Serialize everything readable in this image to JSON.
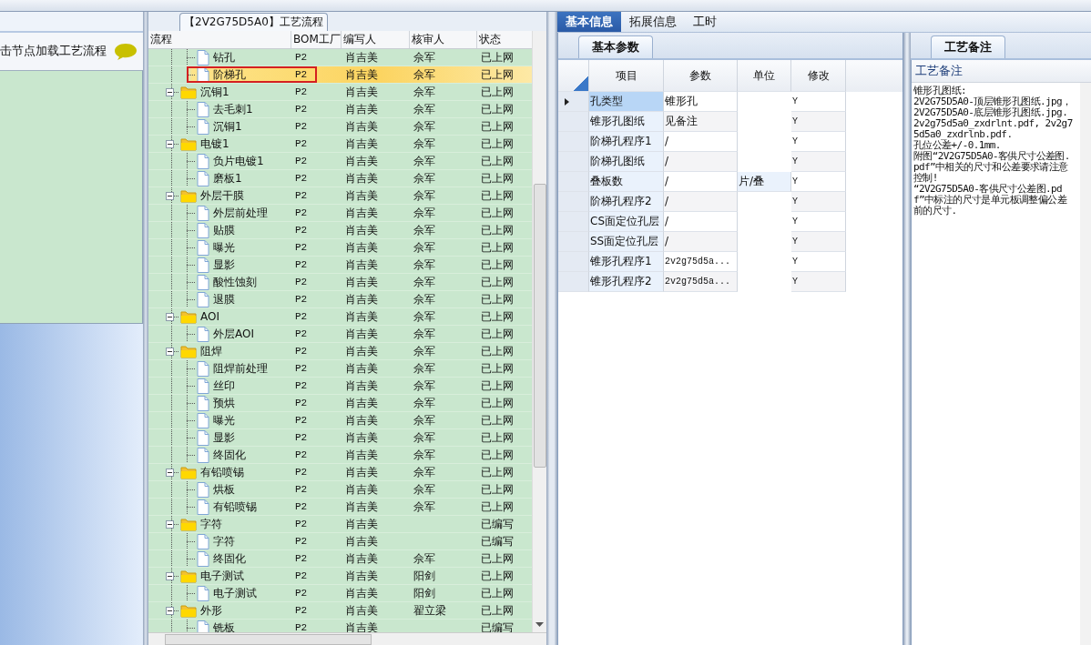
{
  "left_panel": {
    "hint": "击节点加载工艺流程"
  },
  "process_tree": {
    "title": "【2V2G75D5A0】工艺流程",
    "columns": [
      "流程",
      "BOM工厂",
      "编写人",
      "核审人",
      "状态"
    ],
    "groups": [
      {
        "children": [
          {
            "name": "钻孔",
            "bom": "P2",
            "writer": "肖吉美",
            "reviewer": "佘军",
            "status": "已上网",
            "selected": false
          },
          {
            "name": "阶梯孔",
            "bom": "P2",
            "writer": "肖吉美",
            "reviewer": "佘军",
            "status": "已上网",
            "selected": true
          }
        ]
      },
      {
        "name": "沉铜1",
        "bom": "P2",
        "writer": "肖吉美",
        "reviewer": "佘军",
        "status": "已上网",
        "selected": false,
        "expanded": true,
        "children": [
          {
            "name": "去毛刺1",
            "bom": "P2",
            "writer": "肖吉美",
            "reviewer": "佘军",
            "status": "已上网",
            "selected": false
          },
          {
            "name": "沉铜1",
            "bom": "P2",
            "writer": "肖吉美",
            "reviewer": "佘军",
            "status": "已上网",
            "selected": false
          }
        ]
      },
      {
        "name": "电镀1",
        "bom": "P2",
        "writer": "肖吉美",
        "reviewer": "佘军",
        "status": "已上网",
        "selected": false,
        "expanded": true,
        "children": [
          {
            "name": "负片电镀1",
            "bom": "P2",
            "writer": "肖吉美",
            "reviewer": "佘军",
            "status": "已上网",
            "selected": false
          },
          {
            "name": "磨板1",
            "bom": "P2",
            "writer": "肖吉美",
            "reviewer": "佘军",
            "status": "已上网",
            "selected": false
          }
        ]
      },
      {
        "name": "外层干膜",
        "bom": "P2",
        "writer": "肖吉美",
        "reviewer": "佘军",
        "status": "已上网",
        "selected": false,
        "expanded": true,
        "children": [
          {
            "name": "外层前处理",
            "bom": "P2",
            "writer": "肖吉美",
            "reviewer": "佘军",
            "status": "已上网",
            "selected": false
          },
          {
            "name": "贴膜",
            "bom": "P2",
            "writer": "肖吉美",
            "reviewer": "佘军",
            "status": "已上网",
            "selected": false
          },
          {
            "name": "曝光",
            "bom": "P2",
            "writer": "肖吉美",
            "reviewer": "佘军",
            "status": "已上网",
            "selected": false
          },
          {
            "name": "显影",
            "bom": "P2",
            "writer": "肖吉美",
            "reviewer": "佘军",
            "status": "已上网",
            "selected": false
          },
          {
            "name": "酸性蚀刻",
            "bom": "P2",
            "writer": "肖吉美",
            "reviewer": "佘军",
            "status": "已上网",
            "selected": false
          },
          {
            "name": "退膜",
            "bom": "P2",
            "writer": "肖吉美",
            "reviewer": "佘军",
            "status": "已上网",
            "selected": false
          }
        ]
      },
      {
        "name": "AOI",
        "bom": "P2",
        "writer": "肖吉美",
        "reviewer": "佘军",
        "status": "已上网",
        "selected": false,
        "expanded": true,
        "children": [
          {
            "name": "外层AOI",
            "bom": "P2",
            "writer": "肖吉美",
            "reviewer": "佘军",
            "status": "已上网",
            "selected": false
          }
        ]
      },
      {
        "name": "阻焊",
        "bom": "P2",
        "writer": "肖吉美",
        "reviewer": "佘军",
        "status": "已上网",
        "selected": false,
        "expanded": true,
        "children": [
          {
            "name": "阻焊前处理",
            "bom": "P2",
            "writer": "肖吉美",
            "reviewer": "佘军",
            "status": "已上网",
            "selected": false
          },
          {
            "name": "丝印",
            "bom": "P2",
            "writer": "肖吉美",
            "reviewer": "佘军",
            "status": "已上网",
            "selected": false
          },
          {
            "name": "预烘",
            "bom": "P2",
            "writer": "肖吉美",
            "reviewer": "佘军",
            "status": "已上网",
            "selected": false
          },
          {
            "name": "曝光",
            "bom": "P2",
            "writer": "肖吉美",
            "reviewer": "佘军",
            "status": "已上网",
            "selected": false
          },
          {
            "name": "显影",
            "bom": "P2",
            "writer": "肖吉美",
            "reviewer": "佘军",
            "status": "已上网",
            "selected": false
          },
          {
            "name": "终固化",
            "bom": "P2",
            "writer": "肖吉美",
            "reviewer": "佘军",
            "status": "已上网",
            "selected": false
          }
        ]
      },
      {
        "name": "有铅喷锡",
        "bom": "P2",
        "writer": "肖吉美",
        "reviewer": "佘军",
        "status": "已上网",
        "selected": false,
        "expanded": true,
        "children": [
          {
            "name": "烘板",
            "bom": "P2",
            "writer": "肖吉美",
            "reviewer": "佘军",
            "status": "已上网",
            "selected": false
          },
          {
            "name": "有铅喷锡",
            "bom": "P2",
            "writer": "肖吉美",
            "reviewer": "佘军",
            "status": "已上网",
            "selected": false
          }
        ]
      },
      {
        "name": "字符",
        "bom": "P2",
        "writer": "肖吉美",
        "status": "已编写",
        "selected": false,
        "expanded": true,
        "children": [
          {
            "name": "字符",
            "bom": "P2",
            "writer": "肖吉美",
            "status": "已编写",
            "selected": false
          },
          {
            "name": "终固化",
            "bom": "P2",
            "writer": "肖吉美",
            "reviewer": "佘军",
            "status": "已上网",
            "selected": false
          }
        ]
      },
      {
        "name": "电子测试",
        "bom": "P2",
        "writer": "肖吉美",
        "reviewer": "阳剑",
        "status": "已上网",
        "selected": false,
        "expanded": true,
        "children": [
          {
            "name": "电子测试",
            "bom": "P2",
            "writer": "肖吉美",
            "reviewer": "阳剑",
            "status": "已上网",
            "selected": false
          }
        ]
      },
      {
        "name": "外形",
        "bom": "P2",
        "writer": "肖吉美",
        "reviewer": "翟立梁",
        "status": "已上网",
        "selected": false,
        "expanded": true,
        "children": [
          {
            "name": "铣板",
            "bom": "P2",
            "writer": "肖吉美",
            "status": "已编写",
            "selected": false
          }
        ]
      }
    ]
  },
  "tabs": [
    {
      "label": "基本信息",
      "selected": true
    },
    {
      "label": "拓展信息",
      "selected": false
    },
    {
      "label": "工时",
      "selected": false
    }
  ],
  "params": {
    "tab": "基本参数",
    "columns": [
      "项目",
      "参数",
      "单位",
      "修改"
    ],
    "rows": [
      {
        "item": "孔类型",
        "value": "锥形孔",
        "flag": "Y",
        "selected": true
      },
      {
        "item": "锥形孔图纸",
        "value": "见备注",
        "flag": "Y",
        "selected": false
      },
      {
        "item": "阶梯孔程序1",
        "value": "/",
        "flag": "Y",
        "selected": false
      },
      {
        "item": "阶梯孔图纸",
        "value": "/",
        "flag": "Y",
        "selected": false
      },
      {
        "item": "叠板数",
        "value": "/",
        "unit": "片/叠",
        "flag": "Y",
        "selected": false
      },
      {
        "item": "阶梯孔程序2",
        "value": "/",
        "flag": "Y",
        "selected": false
      },
      {
        "item": "CS面定位孔层",
        "value": "/",
        "flag": "Y",
        "selected": false
      },
      {
        "item": "SS面定位孔层",
        "value": "/",
        "flag": "Y",
        "selected": false
      },
      {
        "item": "锥形孔程序1",
        "value": "2v2g75d5a...",
        "flag": "Y",
        "selected": false
      },
      {
        "item": "锥形孔程序2",
        "value": "2v2g75d5a...",
        "flag": "Y",
        "selected": false
      }
    ]
  },
  "notes": {
    "tab": "工艺备注",
    "column": "工艺备注",
    "text": "锥形孔图纸:\n2V2G75D5A0-顶层锥形孔图纸.jpg，2V2G75D5A0-底层锥形孔图纸.jpg. 2v2g75d5a0_zxdrlnt.pdf, 2v2g75d5a0_zxdrlnb.pdf.\n孔位公差+/-0.1mm.\n附图“2V2G75D5A0-客供尺寸公差图.pdf”中相关的尺寸和公差要求请注意控制!\n“2V2G75D5A0-客供尺寸公差图.pdf”中标注的尺寸是单元板调整偏公差前的尺寸."
  }
}
